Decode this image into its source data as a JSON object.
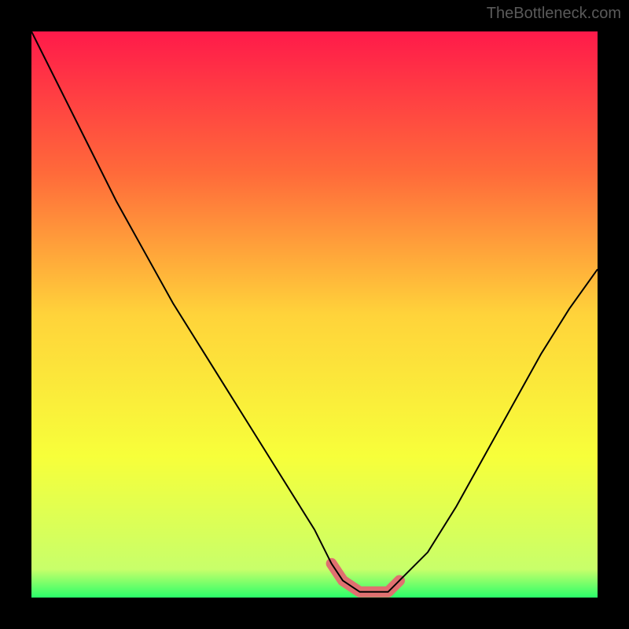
{
  "watermark": "TheBottleneck.com",
  "chart_data": {
    "type": "line",
    "title": "",
    "xlabel": "",
    "ylabel": "",
    "xlim": [
      0,
      100
    ],
    "ylim": [
      0,
      100
    ],
    "gradient_stops": [
      {
        "offset": 0,
        "color": "#ff1a4a"
      },
      {
        "offset": 25,
        "color": "#ff6a3a"
      },
      {
        "offset": 50,
        "color": "#ffd33a"
      },
      {
        "offset": 75,
        "color": "#f7ff3a"
      },
      {
        "offset": 95,
        "color": "#c8ff6a"
      },
      {
        "offset": 100,
        "color": "#2aff6a"
      }
    ],
    "series": [
      {
        "name": "bottleneck-curve",
        "x": [
          0,
          5,
          10,
          15,
          20,
          25,
          30,
          35,
          40,
          45,
          50,
          53,
          55,
          58,
          60,
          63,
          65,
          70,
          75,
          80,
          85,
          90,
          95,
          100
        ],
        "y": [
          100,
          90,
          80,
          70,
          61,
          52,
          44,
          36,
          28,
          20,
          12,
          6,
          3,
          1,
          1,
          1,
          3,
          8,
          16,
          25,
          34,
          43,
          51,
          58
        ]
      }
    ],
    "highlight_segment": {
      "name": "flat-minimum",
      "x": [
        53,
        55,
        58,
        60,
        63,
        65
      ],
      "y": [
        6,
        3,
        1,
        1,
        1,
        3
      ],
      "color": "#e07070",
      "width": 14
    }
  }
}
